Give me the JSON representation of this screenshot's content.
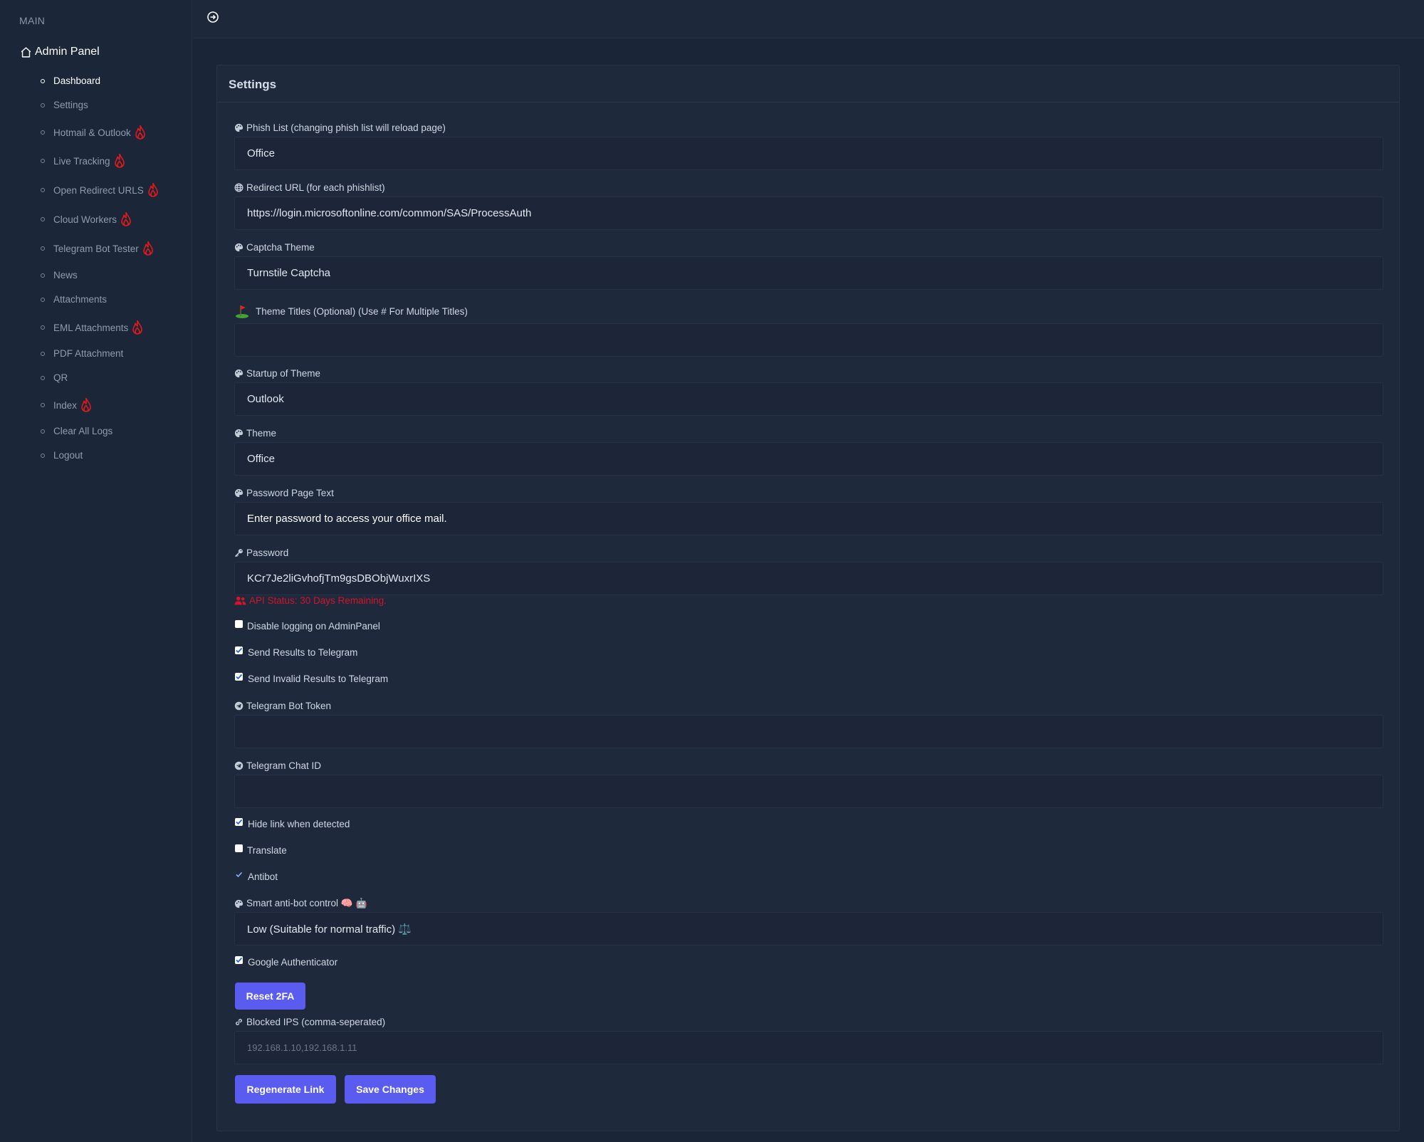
{
  "sidebar": {
    "section": "MAIN",
    "brand": "Admin Panel",
    "items": [
      {
        "label": "Dashboard",
        "hot": false
      },
      {
        "label": "Settings",
        "hot": false
      },
      {
        "label": "Hotmail & Outlook",
        "hot": true
      },
      {
        "label": "Live Tracking",
        "hot": true
      },
      {
        "label": "Open Redirect URLS",
        "hot": true
      },
      {
        "label": "Cloud Workers",
        "hot": true
      },
      {
        "label": "Telegram Bot Tester",
        "hot": true
      },
      {
        "label": "News",
        "hot": false
      },
      {
        "label": "Attachments",
        "hot": false
      },
      {
        "label": "EML Attachments",
        "hot": true
      },
      {
        "label": "PDF Attachment",
        "hot": false
      },
      {
        "label": "QR",
        "hot": false
      },
      {
        "label": "Index",
        "hot": true
      },
      {
        "label": "Clear All Logs",
        "hot": false
      },
      {
        "label": "Logout",
        "hot": false
      }
    ]
  },
  "card": {
    "title": "Settings"
  },
  "fields": {
    "phish_list": {
      "label": "Phish List (changing phish list will reload page)",
      "value": "Office"
    },
    "redirect_url": {
      "label": "Redirect URL (for each phishlist)",
      "value": "https://login.microsoftonline.com/common/SAS/ProcessAuth"
    },
    "captcha_theme": {
      "label": "Captcha Theme",
      "value": "Turnstile Captcha"
    },
    "theme_titles": {
      "label": "Theme Titles (Optional) (Use # For Multiple Titles)",
      "value": ""
    },
    "startup_theme": {
      "label": "Startup of Theme",
      "value": "Outlook"
    },
    "theme": {
      "label": "Theme",
      "value": "Office"
    },
    "password_text": {
      "label": "Password Page Text",
      "value": "Enter password to access your office mail."
    },
    "password": {
      "label": "Password",
      "value": "KCr7Je2liGvhofjTm9gsDBObjWuxrIXS"
    },
    "api_status": "API Status: 30 Days Remaining.",
    "bot_token": {
      "label": "Telegram Bot Token",
      "value": ""
    },
    "chat_id": {
      "label": "Telegram Chat ID",
      "value": ""
    },
    "antibot_level": {
      "label": "Smart anti-bot control 🧠 🤖",
      "value": "Low (Suitable for normal traffic) ⚖️"
    },
    "blocked_ips": {
      "label": "Blocked IPS (comma-seperated)",
      "placeholder": "192.168.1.10,192.168.1.11"
    }
  },
  "checks": {
    "disable_logging": {
      "label": "Disable logging on AdminPanel",
      "checked": false
    },
    "send_results": {
      "label": "Send Results to Telegram",
      "checked": true
    },
    "send_invalid": {
      "label": "Send Invalid Results to Telegram",
      "checked": true
    },
    "hide_link": {
      "label": "Hide link when detected",
      "checked": true
    },
    "translate": {
      "label": "Translate",
      "checked": false
    },
    "antibot": {
      "label": "Antibot",
      "checked": true
    },
    "google_auth": {
      "label": "Google Authenticator",
      "checked": true
    }
  },
  "buttons": {
    "reset_2fa": "Reset 2FA",
    "regenerate": "Regenerate Link",
    "save": "Save Changes"
  },
  "colors": {
    "accent": "#5a5cf0",
    "status": "#d3142a",
    "fire": "#e01a1a"
  }
}
